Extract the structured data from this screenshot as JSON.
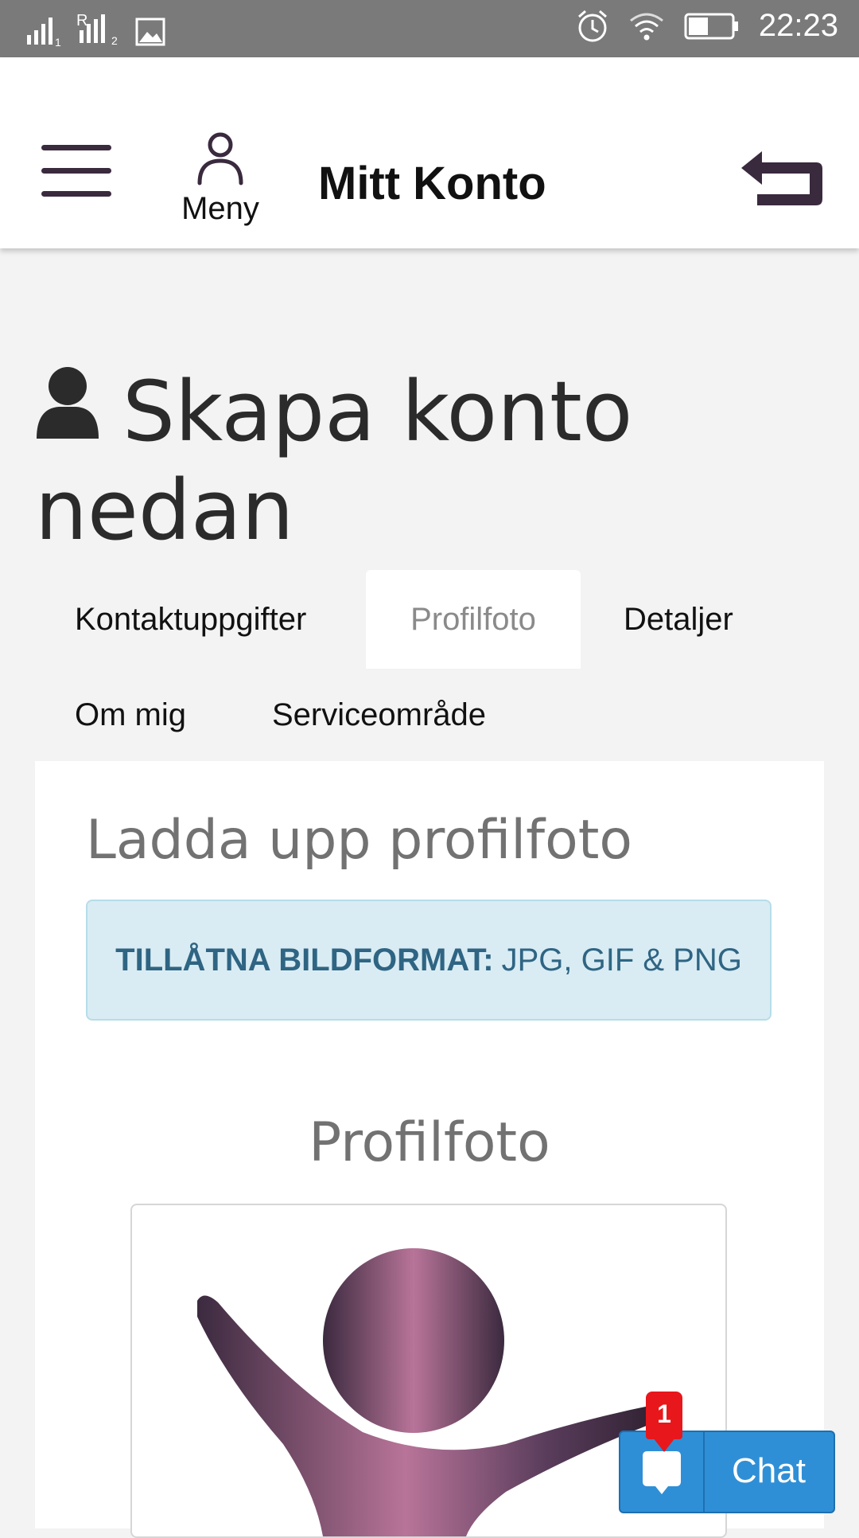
{
  "status_bar": {
    "time": "22:23",
    "sim1_label": "1",
    "sim2_label": "2",
    "roaming_label": "R",
    "icons": [
      "signal-icon",
      "signal-roaming-icon",
      "image-icon",
      "alarm-icon",
      "wifi-icon",
      "battery-icon"
    ]
  },
  "header": {
    "menu_label": "Meny",
    "title": "Mitt Konto"
  },
  "main": {
    "heading": "Skapa konto nedan"
  },
  "tabs": [
    {
      "label": "Kontaktuppgifter",
      "active": false
    },
    {
      "label": "Profilfoto",
      "active": true
    },
    {
      "label": "Detaljer",
      "active": false
    },
    {
      "label": "Om mig",
      "active": false
    },
    {
      "label": "Serviceområde",
      "active": false
    }
  ],
  "panel": {
    "title": "Ladda upp profilfoto",
    "alert_bold": "TILLÅTNA BILDFORMAT:",
    "alert_text": "JPG, GIF & PNG",
    "photo_label": "Profilfoto"
  },
  "chat": {
    "label": "Chat",
    "badge_count": "1"
  },
  "colors": {
    "brand_dark": "#3a2a3e",
    "brand_pink": "#b36f97",
    "chat_blue": "#2f8fd6",
    "badge_red": "#e8171b",
    "alert_text": "#2f6583"
  }
}
